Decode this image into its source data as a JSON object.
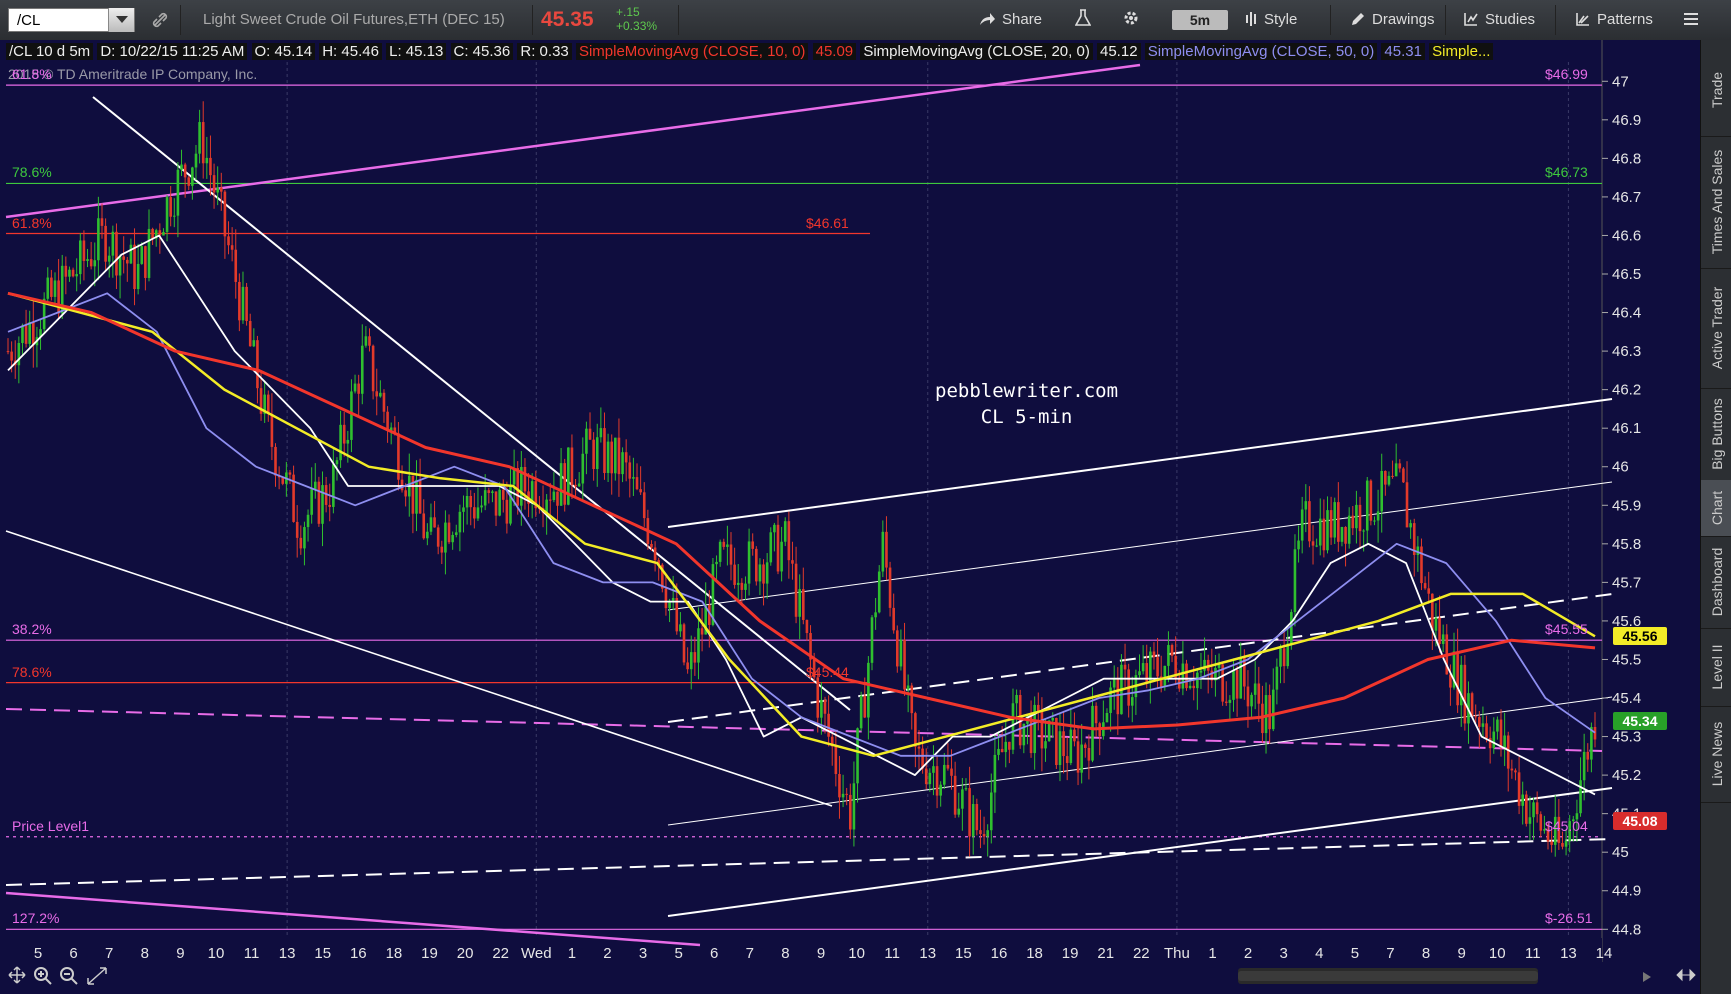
{
  "toolbar": {
    "symbol": "/CL",
    "description": "Light Sweet Crude Oil Futures,ETH (DEC 15)",
    "last_price": "45.35",
    "change": "+.15",
    "change_pct": "+0.33%",
    "share_label": "Share",
    "timeframe": "5m",
    "style_label": "Style",
    "drawings_label": "Drawings",
    "studies_label": "Studies",
    "patterns_label": "Patterns"
  },
  "infobar": {
    "symbol": "/CL 10 d 5m",
    "date": "D: 10/22/15 11:25 AM",
    "open": "O: 45.14",
    "high": "H: 45.46",
    "low": "L: 45.13",
    "close": "C: 45.36",
    "range": "R: 0.33",
    "sma10_label": "SimpleMovingAvg (CLOSE, 10, 0)",
    "sma10_val": "45.09",
    "sma20_label": "SimpleMovingAvg (CLOSE, 20, 0)",
    "sma20_val": "45.12",
    "sma50_label": "SimpleMovingAvg (CLOSE, 50, 0)",
    "sma50_val": "45.31",
    "more": "Simple..."
  },
  "watermark": "2015 © TD Ameritrade IP Company, Inc.",
  "annotation": {
    "line1": "pebblewriter.com",
    "line2": "CL 5-min"
  },
  "levels": [
    {
      "label": "61.8%",
      "value": "$46.99",
      "y": 46.99,
      "color": "#e86ce8"
    },
    {
      "label": "78.6%",
      "value": "$46.73",
      "y": 46.735,
      "color": "#3ec83e"
    },
    {
      "label": "61.8%",
      "value": "$46.61",
      "y": 46.605,
      "color": "#f2362c"
    },
    {
      "label": "38.2%",
      "value": "$45.55",
      "y": 45.55,
      "color": "#e86ce8"
    },
    {
      "label": "78.6%",
      "value": "$45.44",
      "y": 45.44,
      "color": "#f2362c"
    },
    {
      "label": "Price Level1",
      "value": "$45.04",
      "y": 45.04,
      "color": "#e86ce8"
    },
    {
      "label": "127.2%",
      "value": "$-26.51",
      "y": 44.8,
      "color": "#e86ce8"
    }
  ],
  "price_badges": [
    {
      "value": "45.56",
      "bg": "#f3ec27",
      "fg": "#000"
    },
    {
      "value": "45.34",
      "bg": "#28a028",
      "fg": "#fff"
    },
    {
      "value": "45.08",
      "bg": "#d82c2c",
      "fg": "#fff"
    }
  ],
  "sidebar_tabs": [
    "Trade",
    "Times And Sales",
    "Active Trader",
    "Big Buttons",
    "Chart",
    "Dashboard",
    "Level II",
    "Live News"
  ],
  "chart_data": {
    "type": "candlestick",
    "ylim": [
      44.78,
      47.05
    ],
    "yticks": [
      47,
      46.9,
      46.8,
      46.7,
      46.6,
      46.5,
      46.4,
      46.3,
      46.2,
      46.1,
      46,
      45.9,
      45.8,
      45.7,
      45.6,
      45.5,
      45.4,
      45.3,
      45.2,
      45.1,
      45,
      44.9,
      44.8
    ],
    "xticks": [
      "5",
      "6",
      "7",
      "8",
      "9",
      "10",
      "11",
      "13",
      "15",
      "16",
      "18",
      "19",
      "20",
      "22",
      "Wed",
      "1",
      "2",
      "3",
      "5",
      "6",
      "7",
      "8",
      "9",
      "10",
      "11",
      "13",
      "15",
      "16",
      "18",
      "19",
      "21",
      "22",
      "Thu",
      "1",
      "2",
      "3",
      "4",
      "5",
      "7",
      "8",
      "9",
      "10",
      "11",
      "13",
      "14"
    ],
    "series": [
      {
        "name": "price (close)",
        "color": "#f2362c",
        "values": [
          46.3,
          46.4,
          46.5,
          46.6,
          46.5,
          46.7,
          46.85,
          46.5,
          46.1,
          45.85,
          45.95,
          46.3,
          46.05,
          45.8,
          45.9,
          45.9,
          45.95,
          45.95,
          46.05,
          46.0,
          45.8,
          45.45,
          45.75,
          45.75,
          45.8,
          45.4,
          45.1,
          45.8,
          45.25,
          45.2,
          45.05,
          45.35,
          45.3,
          45.25,
          45.4,
          45.45,
          45.5,
          45.45,
          45.45,
          45.35,
          45.85,
          45.85,
          45.9,
          45.95,
          45.6,
          45.4,
          45.3,
          45.1,
          45.0,
          45.35
        ]
      },
      {
        "name": "SMA 10",
        "color": "#ffffff",
        "values": [
          46.25,
          46.35,
          46.45,
          46.55,
          46.6,
          46.45,
          46.3,
          46.2,
          46.1,
          45.95,
          45.95,
          45.95,
          45.95,
          45.95,
          45.9,
          45.8,
          45.7,
          45.65,
          45.65,
          45.5,
          45.3,
          45.35,
          45.3,
          45.25,
          45.2,
          45.3,
          45.3,
          45.35,
          45.4,
          45.45,
          45.45,
          45.45,
          45.45,
          45.5,
          45.6,
          45.75,
          45.8,
          45.75,
          45.5,
          45.3,
          45.25,
          45.2,
          45.15
        ]
      },
      {
        "name": "SMA 20",
        "color": "#8e8ef0",
        "values": [
          46.35,
          46.4,
          46.45,
          46.35,
          46.1,
          46.0,
          45.95,
          45.9,
          45.95,
          46.0,
          45.95,
          45.75,
          45.7,
          45.7,
          45.65,
          45.45,
          45.35,
          45.3,
          45.25,
          45.25,
          45.3,
          45.35,
          45.4,
          45.42,
          45.45,
          45.5,
          45.6,
          45.7,
          45.8,
          45.75,
          45.6,
          45.4,
          45.31
        ]
      },
      {
        "name": "SMA 50",
        "color": "#f3ec27",
        "values": [
          46.45,
          46.4,
          46.35,
          46.2,
          46.1,
          46.0,
          45.97,
          45.95,
          45.8,
          45.75,
          45.5,
          45.3,
          45.25,
          45.3,
          45.35,
          45.4,
          45.45,
          45.5,
          45.55,
          45.6,
          45.67,
          45.67,
          45.56
        ]
      },
      {
        "name": "SMA 200",
        "color": "#f2362c",
        "values": [
          46.45,
          46.4,
          46.3,
          46.25,
          46.15,
          46.05,
          46.0,
          45.9,
          45.8,
          45.6,
          45.45,
          45.4,
          45.35,
          45.32,
          45.33,
          45.35,
          45.4,
          45.5,
          45.55,
          45.53
        ]
      }
    ]
  }
}
